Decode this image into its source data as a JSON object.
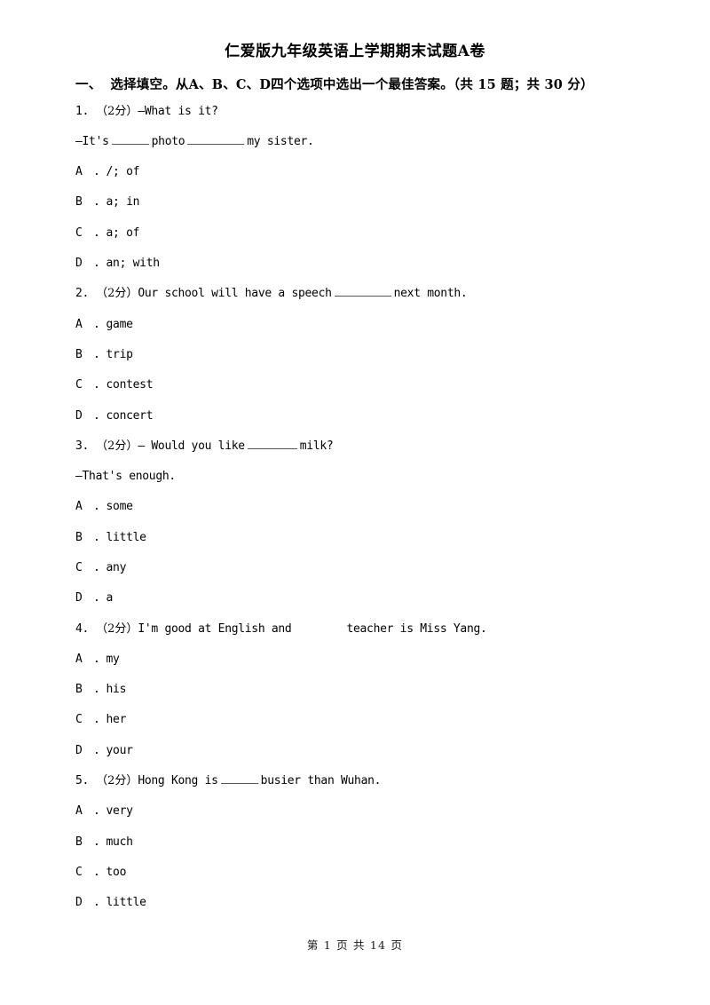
{
  "document": {
    "title": "仁爱版九年级英语上学期期末试题A卷",
    "footer": "第 1 页  共 14 页"
  },
  "section": {
    "number": "一、",
    "heading": "选择填空。从A、B、C、D四个选项中选出一个最佳答案。（共 15 题；共 30 分）"
  },
  "questions": [
    {
      "number": "1.",
      "marks": "（2分）",
      "stem_pre": "—What is it?",
      "line2_a": "—It's",
      "line2_b": "photo",
      "line2_c": "my sister.",
      "options": [
        {
          "letter": "A",
          "sep": ".",
          "text": "/; of"
        },
        {
          "letter": "B",
          "sep": ".",
          "text": "a; in"
        },
        {
          "letter": "C",
          "sep": ".",
          "text": "a; of"
        },
        {
          "letter": "D",
          "sep": ".",
          "text": "an; with"
        }
      ]
    },
    {
      "number": "2.",
      "marks": "（2分）",
      "stem_a": "Our school will have a speech",
      "stem_b": "next month.",
      "options": [
        {
          "letter": "A",
          "sep": ".",
          "text": "game"
        },
        {
          "letter": "B",
          "sep": ".",
          "text": "trip"
        },
        {
          "letter": "C",
          "sep": ".",
          "text": "contest"
        },
        {
          "letter": "D",
          "sep": ".",
          "text": "concert"
        }
      ]
    },
    {
      "number": "3.",
      "marks": "（2分）",
      "stem_a": "— Would you like",
      "stem_b": "milk?",
      "line2": "—That's enough.",
      "options": [
        {
          "letter": "A",
          "sep": ".",
          "text": "some"
        },
        {
          "letter": "B",
          "sep": ".",
          "text": "little"
        },
        {
          "letter": "C",
          "sep": ".",
          "text": "any"
        },
        {
          "letter": "D",
          "sep": ".",
          "text": "a"
        }
      ]
    },
    {
      "number": "4.",
      "marks": "（2分）",
      "stem_a": "I'm good at English and",
      "stem_b": "teacher is Miss Yang.",
      "options": [
        {
          "letter": "A",
          "sep": ".",
          "text": "my"
        },
        {
          "letter": "B",
          "sep": ".",
          "text": "his"
        },
        {
          "letter": "C",
          "sep": ".",
          "text": "her"
        },
        {
          "letter": "D",
          "sep": ".",
          "text": "your"
        }
      ]
    },
    {
      "number": "5.",
      "marks": "（2分）",
      "stem_a": "Hong Kong is",
      "stem_b": "busier than Wuhan.",
      "options": [
        {
          "letter": "A",
          "sep": ".",
          "text": "very"
        },
        {
          "letter": "B",
          "sep": ".",
          "text": "much"
        },
        {
          "letter": "C",
          "sep": ".",
          "text": "too"
        },
        {
          "letter": "D",
          "sep": ".",
          "text": "little"
        }
      ]
    }
  ]
}
